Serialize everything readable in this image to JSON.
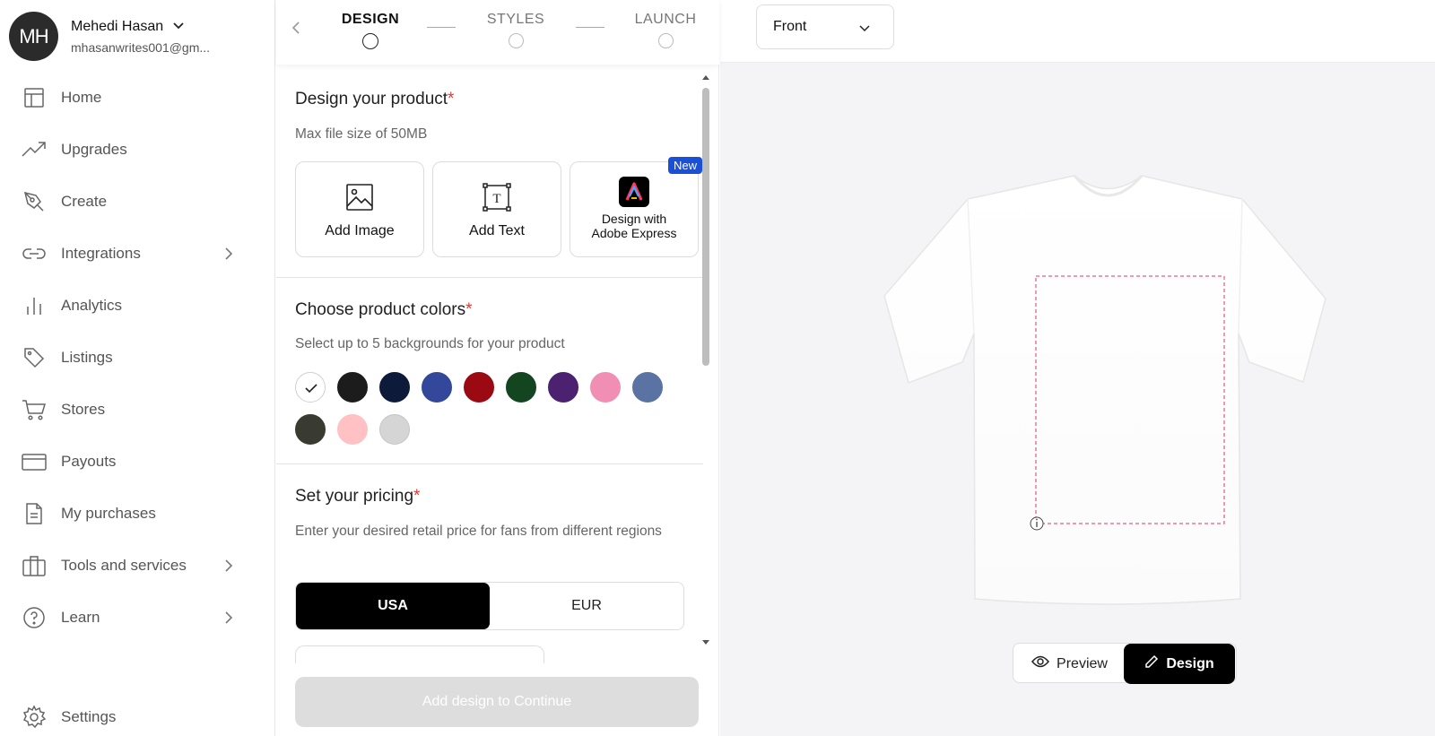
{
  "user": {
    "initials": "MH",
    "name": "Mehedi Hasan",
    "email": "mhasanwrites001@gm..."
  },
  "nav": [
    {
      "label": "Home",
      "icon": "home-icon",
      "chevron": false
    },
    {
      "label": "Upgrades",
      "icon": "trending-up-icon",
      "chevron": false
    },
    {
      "label": "Create",
      "icon": "pen-tool-icon",
      "chevron": false
    },
    {
      "label": "Integrations",
      "icon": "link-icon",
      "chevron": true
    },
    {
      "label": "Analytics",
      "icon": "bar-chart-icon",
      "chevron": false
    },
    {
      "label": "Listings",
      "icon": "tag-icon",
      "chevron": false
    },
    {
      "label": "Stores",
      "icon": "cart-icon",
      "chevron": false
    },
    {
      "label": "Payouts",
      "icon": "credit-card-icon",
      "chevron": false
    },
    {
      "label": "My purchases",
      "icon": "document-icon",
      "chevron": false
    },
    {
      "label": "Tools and services",
      "icon": "briefcase-icon",
      "chevron": true
    },
    {
      "label": "Learn",
      "icon": "help-circle-icon",
      "chevron": true
    }
  ],
  "settings": {
    "label": "Settings",
    "icon": "gear-icon"
  },
  "steps": [
    {
      "label": "DESIGN",
      "state": "active"
    },
    {
      "label": "STYLES",
      "state": "inactive"
    },
    {
      "label": "LAUNCH",
      "state": "inactive"
    }
  ],
  "design": {
    "title": "Design your product",
    "required_mark": "*",
    "subtitle": "Max file size of 50MB",
    "cards": {
      "image": "Add Image",
      "text": "Add Text",
      "adobe": "Design with Adobe Express"
    },
    "badge": "New"
  },
  "colors": {
    "title": "Choose product colors",
    "subtitle": "Select up to 5 backgrounds for your product",
    "swatches": [
      "#ffffff",
      "#1c1c1c",
      "#0e1a3a",
      "#33489a",
      "#9b0a12",
      "#144521",
      "#4b2170",
      "#f08fb3",
      "#5b73a3",
      "#3a3b30",
      "#ffc1c4",
      "#d5d5d5"
    ],
    "selected_index": 0
  },
  "pricing": {
    "title": "Set your pricing",
    "subtitle": "Enter your desired retail price for fans from different regions",
    "regions": [
      "USA",
      "EUR"
    ],
    "selected": "USA"
  },
  "continue_label": "Add design to Continue",
  "view": {
    "side": "Front"
  },
  "toggle": {
    "preview": "Preview",
    "design": "Design",
    "selected": "Design"
  },
  "theme": {
    "accent": "#1a4fd8",
    "required": "#e53935",
    "print_area": "#e3326b"
  }
}
